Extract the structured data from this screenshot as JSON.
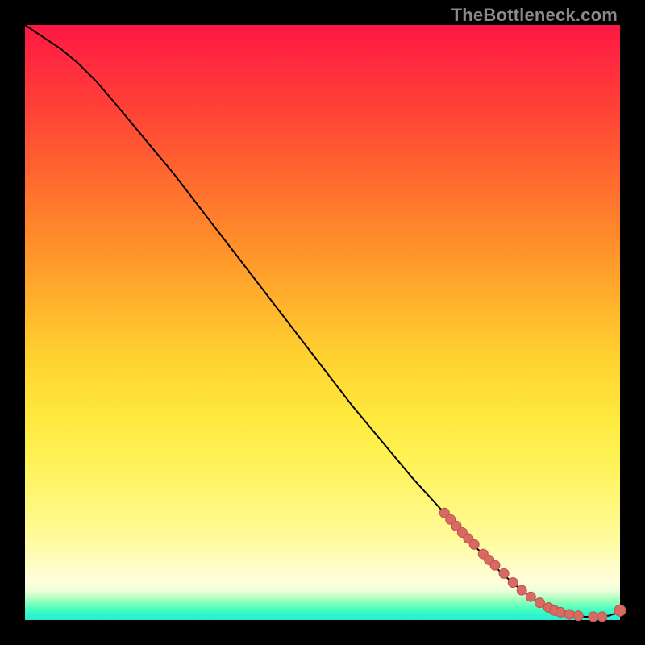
{
  "watermark": "TheBottleneck.com",
  "chart_data": {
    "type": "line",
    "title": "",
    "xlabel": "",
    "ylabel": "",
    "xlim": [
      0,
      100
    ],
    "ylim": [
      0,
      100
    ],
    "curve": {
      "x": [
        0,
        3,
        6,
        9,
        12,
        15,
        20,
        25,
        30,
        35,
        40,
        45,
        50,
        55,
        60,
        65,
        70,
        75,
        80,
        82,
        84,
        86,
        88,
        90,
        92,
        94,
        96,
        98,
        99,
        100
      ],
      "y": [
        100,
        98,
        96,
        93.5,
        90.5,
        87,
        81,
        75,
        68.5,
        62,
        55.5,
        49,
        42.5,
        36,
        30,
        24,
        18.5,
        13,
        8,
        6.2,
        4.6,
        3.2,
        2.1,
        1.3,
        0.8,
        0.55,
        0.5,
        0.7,
        1.0,
        1.6
      ]
    },
    "points": {
      "x": [
        70.5,
        71.5,
        72.5,
        73.5,
        74.5,
        75.5,
        77.0,
        78.0,
        79.0,
        80.5,
        82.0,
        83.5,
        85.0,
        86.5,
        88.0,
        89.0,
        90.0,
        91.5,
        93.0,
        95.5,
        97.0,
        100.0
      ],
      "y": [
        18.0,
        16.9,
        15.8,
        14.7,
        13.7,
        12.7,
        11.1,
        10.1,
        9.2,
        7.8,
        6.3,
        5.0,
        3.9,
        2.9,
        2.1,
        1.6,
        1.3,
        0.95,
        0.7,
        0.55,
        0.55,
        1.6
      ]
    },
    "gradient_bands": [
      {
        "color": "#ff1744",
        "stop": 0
      },
      {
        "color": "#ffd230",
        "stop": 56
      },
      {
        "color": "#fffb99",
        "stop": 86
      },
      {
        "color": "#46ffc0",
        "stop": 98
      },
      {
        "color": "#2ee8d8",
        "stop": 100
      }
    ]
  }
}
